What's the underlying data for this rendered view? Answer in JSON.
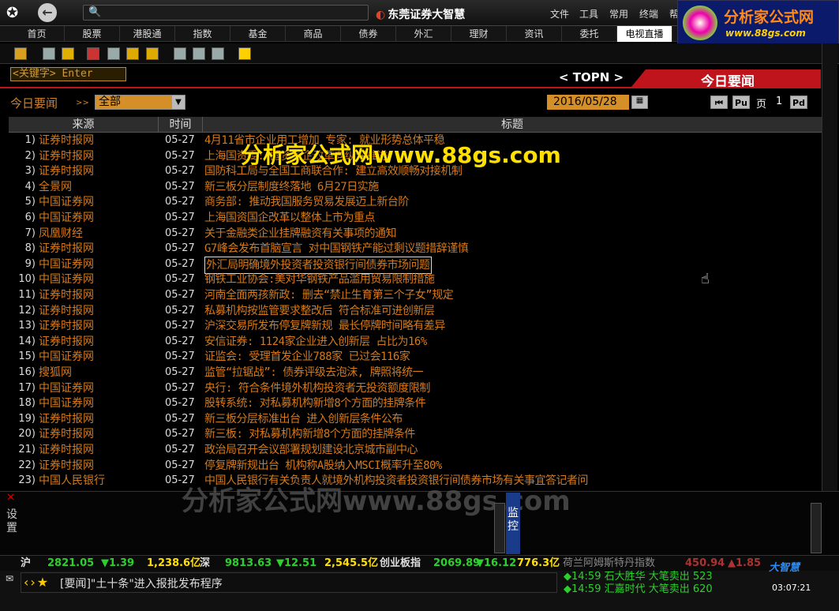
{
  "app": {
    "title": "东莞证券大智慧"
  },
  "topmenu": [
    "文件",
    "工具",
    "常用",
    "终端",
    "帮"
  ],
  "brand": {
    "name": "分析家公式网",
    "url": "www.88gs.com"
  },
  "nav": [
    "首页",
    "股票",
    "港股通",
    "指数",
    "基金",
    "商品",
    "债券",
    "外汇",
    "理财",
    "资讯",
    "委托",
    "电视直播"
  ],
  "keyword_input": "<关键字> Enter",
  "topn": "< TOPN >",
  "section_title": "今日要闻",
  "filter": {
    "label": "今日要闻",
    "arrows": ">>",
    "value": "全部"
  },
  "date": "2016/05/28",
  "pager": {
    "first": "⏮",
    "prev": "Pu",
    "label": "页",
    "num": "1",
    "next": "Pd"
  },
  "columns": [
    "来源",
    "时间",
    "标题"
  ],
  "rows": [
    {
      "n": "1)",
      "src": "证券时报网",
      "t": "05-27",
      "title": "4月11省市企业用工增加 专家: 就业形势总体平稳"
    },
    {
      "n": "2)",
      "src": "证券时报网",
      "t": "05-27",
      "title": "上海国资委: 国资国企改革向纵深推进"
    },
    {
      "n": "3)",
      "src": "证券时报网",
      "t": "05-27",
      "title": "国防科工局与全国工商联合作: 建立高效顺畅对接机制"
    },
    {
      "n": "4)",
      "src": "全景网",
      "t": "05-27",
      "title": "新三板分层制度终落地 6月27日实施"
    },
    {
      "n": "5)",
      "src": "中国证券网",
      "t": "05-27",
      "title": "商务部: 推动我国服务贸易发展迈上新台阶"
    },
    {
      "n": "6)",
      "src": "中国证券网",
      "t": "05-27",
      "title": "上海国资国企改革以整体上市为重点"
    },
    {
      "n": "7)",
      "src": "凤凰财经",
      "t": "05-27",
      "title": "关于金融类企业挂牌融资有关事项的通知"
    },
    {
      "n": "8)",
      "src": "证券时报网",
      "t": "05-27",
      "title": "G7峰会发布首脑宣言 对中国钢铁产能过剩议题措辞谨慎"
    },
    {
      "n": "9)",
      "src": "中国证券网",
      "t": "05-27",
      "title": "外汇局明确境外投资者投资银行间债券市场问题"
    },
    {
      "n": "10)",
      "src": "中国证券网",
      "t": "05-27",
      "title": "钢铁工业协会:美对华钢铁产品滥用贸易限制措施"
    },
    {
      "n": "11)",
      "src": "证券时报网",
      "t": "05-27",
      "title": "河南全面两孩新政: 删去“禁止生育第三个子女”规定"
    },
    {
      "n": "12)",
      "src": "证券时报网",
      "t": "05-27",
      "title": "私募机构按监管要求整改后 符合标准可进创新层"
    },
    {
      "n": "13)",
      "src": "证券时报网",
      "t": "05-27",
      "title": "沪深交易所发布停复牌新规 最长停牌时间略有差异"
    },
    {
      "n": "14)",
      "src": "证券时报网",
      "t": "05-27",
      "title": "安信证券: 1124家企业进入创新层 占比为16%"
    },
    {
      "n": "15)",
      "src": "中国证券网",
      "t": "05-27",
      "title": "证监会: 受理首发企业788家 已过会116家"
    },
    {
      "n": "16)",
      "src": "搜狐网",
      "t": "05-27",
      "title": "监管“拉锯战”: 债券评级去泡沫, 牌照将统一"
    },
    {
      "n": "17)",
      "src": "中国证券网",
      "t": "05-27",
      "title": "央行: 符合条件境外机构投资者无投资额度限制"
    },
    {
      "n": "18)",
      "src": "中国证券网",
      "t": "05-27",
      "title": "股转系统: 对私募机构新增8个方面的挂牌条件"
    },
    {
      "n": "19)",
      "src": "证券时报网",
      "t": "05-27",
      "title": "新三板分层标准出台 进入创新层条件公布"
    },
    {
      "n": "20)",
      "src": "证券时报网",
      "t": "05-27",
      "title": "新三板: 对私募机构新增8个方面的挂牌条件"
    },
    {
      "n": "21)",
      "src": "证券时报网",
      "t": "05-27",
      "title": "政治局召开会议部署规划建设北京城市副中心"
    },
    {
      "n": "22)",
      "src": "证券时报网",
      "t": "05-27",
      "title": "停复牌新规出台 机构称A股纳入MSCI概率升至80%"
    },
    {
      "n": "23)",
      "src": "中国人民银行",
      "t": "05-27",
      "title": "中国人民银行有关负责人就境外机构投资者投资银行间债券市场有关事宜答记者问"
    }
  ],
  "watermark1": "分析家公式网www.88gs.com",
  "watermark2": "分析家公式网www.88gs.com",
  "left_panel": "设置",
  "right_panel": "监控",
  "ticker": [
    {
      "text": "沪",
      "color": "#ddd"
    },
    {
      "text": "2821.05",
      "color": "#2cd02c"
    },
    {
      "text": "▼1.39",
      "color": "#2cd02c"
    },
    {
      "text": "1,238.6亿",
      "color": "#ffe000"
    },
    {
      "text": "深",
      "color": "#ddd"
    },
    {
      "text": "9813.63",
      "color": "#2cd02c"
    },
    {
      "text": "▼12.51",
      "color": "#2cd02c"
    },
    {
      "text": "2,545.5亿",
      "color": "#ffe000"
    },
    {
      "text": "创业板指",
      "color": "#ddd"
    },
    {
      "text": "2069.89",
      "color": "#2cd02c"
    },
    {
      "text": "▼16.12",
      "color": "#2cd02c"
    },
    {
      "text": "776.3亿",
      "color": "#ffe000"
    },
    {
      "text": "荷兰阿姆斯特丹指数",
      "color": "#888"
    },
    {
      "text": "450.94",
      "color": "#a33"
    },
    {
      "text": "▲1.85",
      "color": "#a33"
    }
  ],
  "message": "[要闻]\"土十条\"进入报批发布程序",
  "trades": [
    {
      "text": "◆14:59 石大胜华 大笔卖出 523"
    },
    {
      "text": "◆14:59 汇嘉时代 大笔卖出 620"
    }
  ],
  "clock": "03:07:21",
  "dzh_logo": "大智慧"
}
